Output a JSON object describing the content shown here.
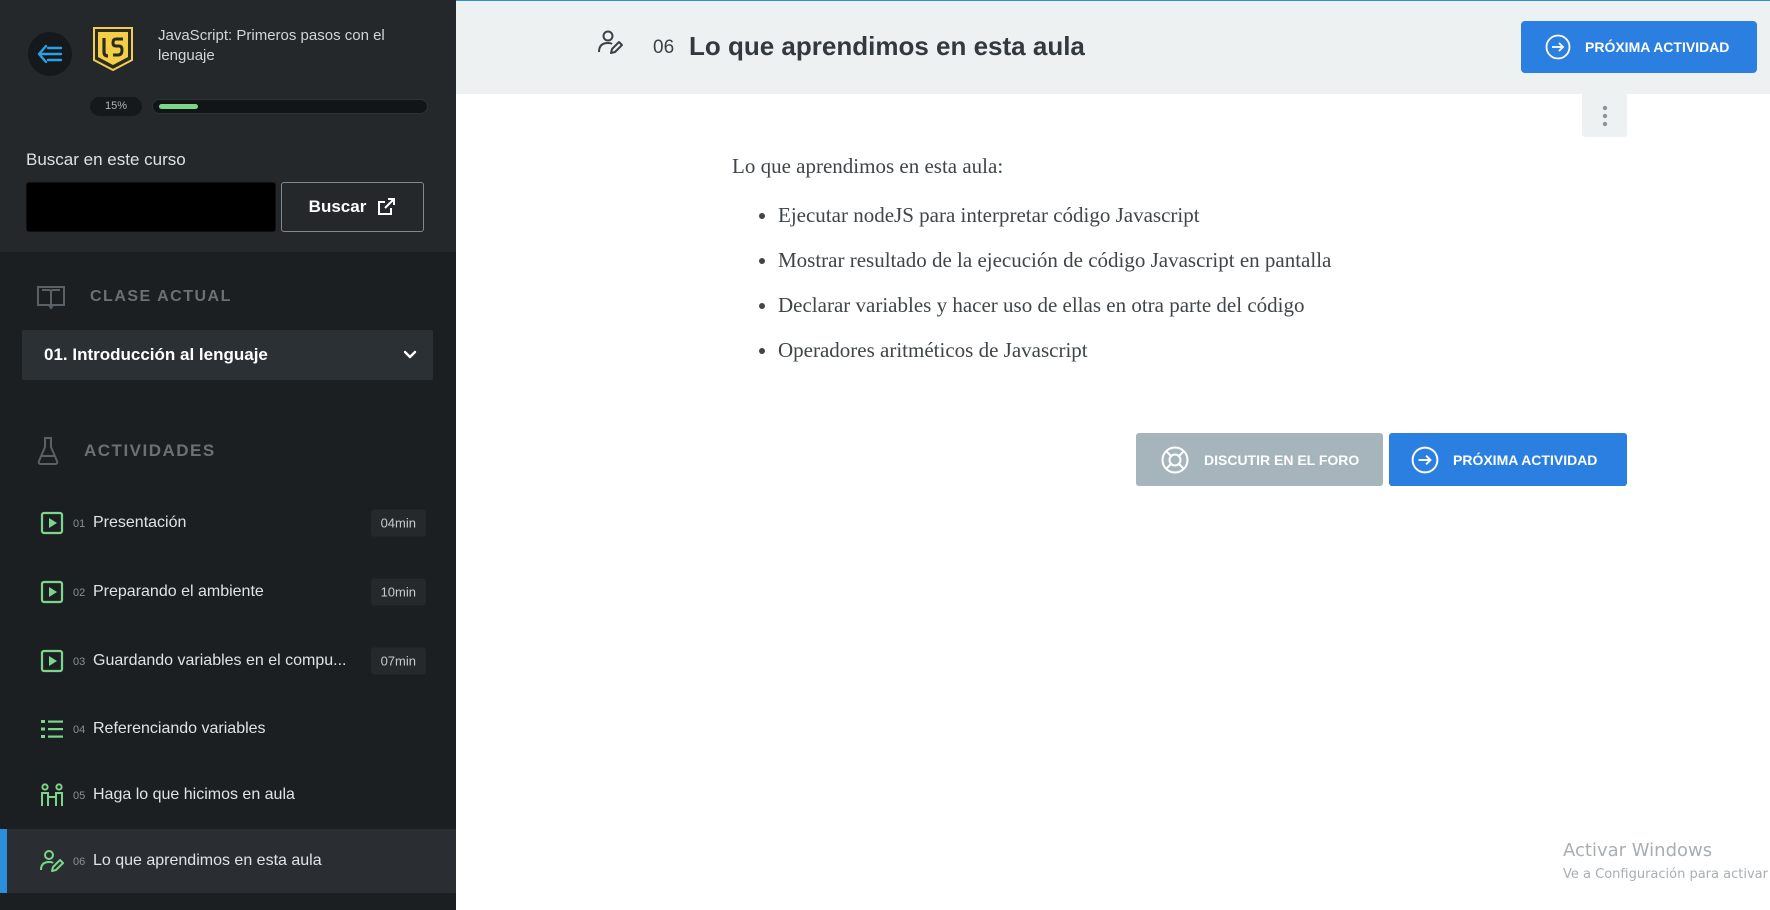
{
  "colors": {
    "accent": "#2b7fe0",
    "sidebar_bg": "#1c1f22",
    "progress_green": "#7bd68a",
    "icon_green": "#7bd68a",
    "active_marker": "#2b8fde"
  },
  "sidebar": {
    "course_title": "JavaScript: Primeros pasos con el lenguaje",
    "logo_icon": "javascript-js-logo",
    "progress": {
      "label": "15%",
      "value": 15
    },
    "search": {
      "label": "Buscar en este curso",
      "value": "",
      "placeholder": "",
      "button_label": "Buscar"
    },
    "current_class_header": "CLASE ACTUAL",
    "current_class": "01. Introducción al lenguaje",
    "activities_header": "ACTIVIDADES",
    "activities": [
      {
        "num": "01",
        "label": "Presentación",
        "duration": "04min",
        "icon": "video-play-icon"
      },
      {
        "num": "02",
        "label": "Preparando el ambiente",
        "duration": "10min",
        "icon": "video-play-icon"
      },
      {
        "num": "03",
        "label": "Guardando variables en el compu...",
        "duration": "07min",
        "icon": "video-play-icon"
      },
      {
        "num": "04",
        "label": "Referenciando variables",
        "duration": "",
        "icon": "list-icon"
      },
      {
        "num": "05",
        "label": "Haga lo que hicimos en aula",
        "duration": "",
        "icon": "people-practice-icon"
      },
      {
        "num": "06",
        "label": "Lo que aprendimos en esta aula",
        "duration": "",
        "icon": "user-edit-icon",
        "active": true
      }
    ]
  },
  "header": {
    "lesson_number": "06",
    "lesson_title": "Lo que aprendimos en esta aula",
    "next_button": "PRÓXIMA ACTIVIDAD"
  },
  "content": {
    "intro": "Lo que aprendimos en esta aula:",
    "bullets": [
      "Ejecutar nodeJS para interpretar código Javascript",
      "Mostrar resultado de la ejecución de código Javascript en pantalla",
      "Declarar variables y hacer uso de ellas en otra parte del código",
      "Operadores aritméticos de Javascript"
    ],
    "forum_button": "DISCUTIR EN EL FORO",
    "next_button": "PRÓXIMA ACTIVIDAD"
  },
  "watermark": {
    "line1": "Activar Windows",
    "line2": "Ve a Configuración para activar"
  }
}
